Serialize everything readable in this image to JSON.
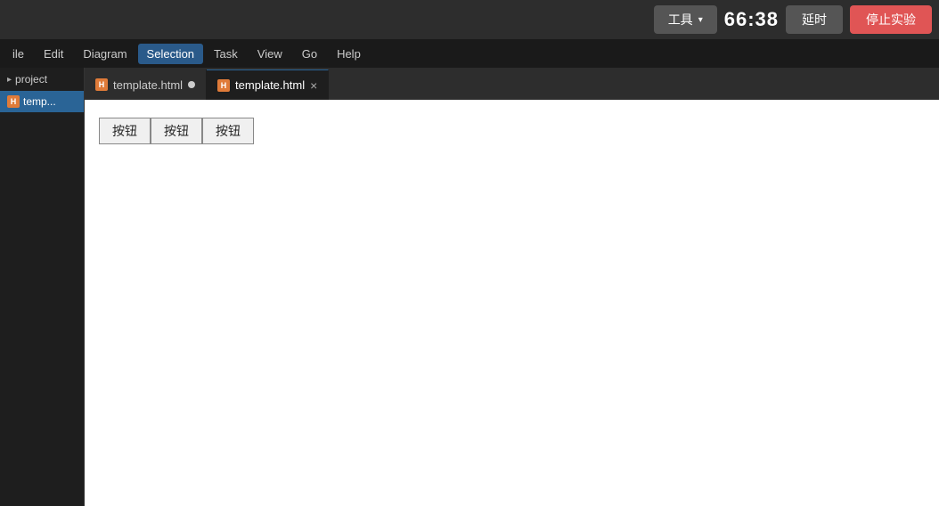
{
  "topbar": {
    "tool_label": "工具",
    "tool_chevron": "▾",
    "timer": "66:38",
    "delay_label": "延时",
    "stop_label": "停止实验"
  },
  "menubar": {
    "items": [
      {
        "id": "file",
        "label": "ile"
      },
      {
        "id": "edit",
        "label": "Edit"
      },
      {
        "id": "diagram",
        "label": "Diagram"
      },
      {
        "id": "selection",
        "label": "Selection",
        "active": true
      },
      {
        "id": "task",
        "label": "Task"
      },
      {
        "id": "view",
        "label": "View"
      },
      {
        "id": "go",
        "label": "Go"
      },
      {
        "id": "help",
        "label": "Help"
      }
    ]
  },
  "sidebar": {
    "project_label": "project",
    "file_label": "temp..."
  },
  "tabs": [
    {
      "id": "tab1",
      "label": "template.html",
      "has_dot": true,
      "active": false
    },
    {
      "id": "tab2",
      "label": "template.html",
      "has_close": true,
      "active": true
    }
  ],
  "preview": {
    "buttons": [
      "按钮",
      "按钮",
      "按钮"
    ]
  }
}
